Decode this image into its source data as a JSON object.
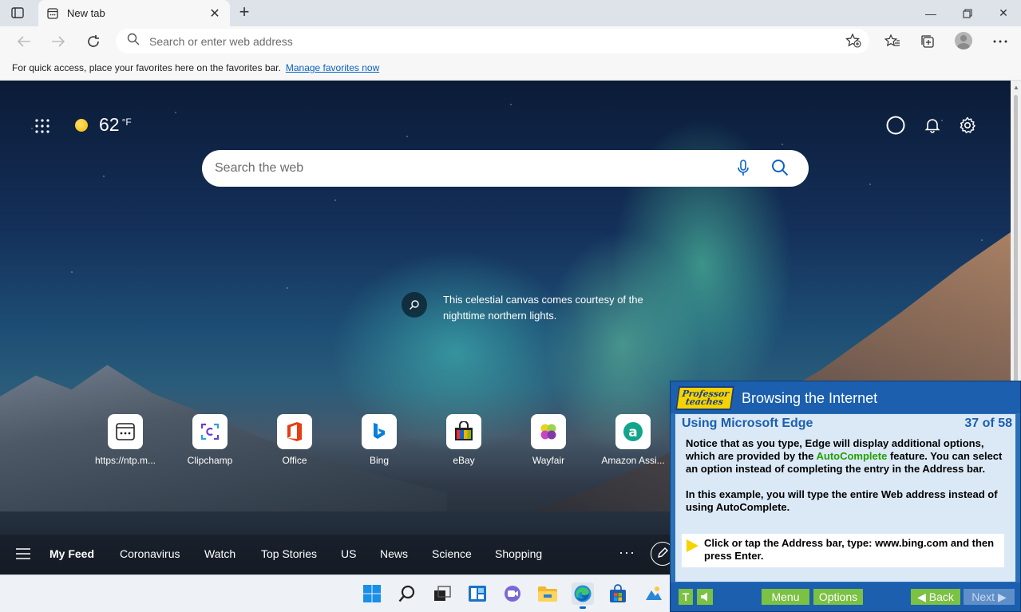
{
  "browser": {
    "tab_title": "New tab",
    "address_placeholder": "Search or enter web address",
    "favbar_text": "For quick access, place your favorites here on the favorites bar.",
    "favbar_link": "Manage favorites now"
  },
  "ntp": {
    "weather_temp": "62",
    "weather_unit": "°F",
    "search_placeholder": "Search the web",
    "caption": "This celestial canvas comes courtesy of the nighttime northern lights.",
    "quicklinks": [
      {
        "label": "https://ntp.m...",
        "icon": "website-icon"
      },
      {
        "label": "Clipchamp",
        "icon": "clipchamp-icon"
      },
      {
        "label": "Office",
        "icon": "office-icon"
      },
      {
        "label": "Bing",
        "icon": "bing-icon"
      },
      {
        "label": "eBay",
        "icon": "ebay-icon"
      },
      {
        "label": "Wayfair",
        "icon": "wayfair-icon"
      },
      {
        "label": "Amazon Assi...",
        "icon": "amazon-icon"
      }
    ],
    "feed": [
      "My Feed",
      "Coronavirus",
      "Watch",
      "Top Stories",
      "US",
      "News",
      "Science",
      "Shopping"
    ],
    "feed_more": "···"
  },
  "tutorial": {
    "logo_text": "Professor teaches",
    "title": "Browsing the Internet",
    "lesson": "Using Microsoft Edge",
    "count": "37 of 58",
    "para1_a": "Notice that as you type, Edge will display additional options, which are provided by the ",
    "para1_hl": "AutoComplete",
    "para1_b": " feature. You can select an option instead of completing the entry in the Address bar.",
    "para2": "In this example, you will type the entire Web address instead of using AutoComplete.",
    "instruction": "Click or tap the Address bar, type: www.bing.com and then press Enter.",
    "btn_t": "T",
    "btn_menu": "Menu",
    "btn_options": "Options",
    "btn_back": "◀ Back",
    "btn_next": "Next ▶"
  },
  "colors": {
    "accent": "#0b61c4",
    "tutor_blue": "#1b5fae",
    "tutor_green": "#7bc142",
    "highlight_green": "#22a000"
  }
}
